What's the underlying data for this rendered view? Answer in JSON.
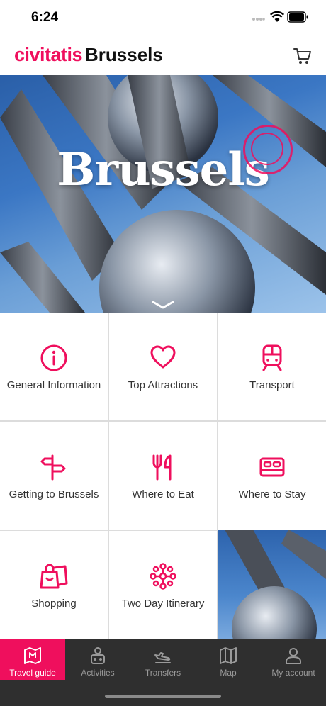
{
  "status_bar": {
    "time": "6:24"
  },
  "header": {
    "logo": "civitatis",
    "city": "Brussels"
  },
  "hero": {
    "title": "Brussels"
  },
  "colors": {
    "accent": "#ef0f5d",
    "tabbar": "#2f2f2f"
  },
  "menu": [
    {
      "label": "General Information",
      "icon": "info-icon"
    },
    {
      "label": "Top Attractions",
      "icon": "heart-icon"
    },
    {
      "label": "Transport",
      "icon": "train-icon"
    },
    {
      "label": "Getting to Brussels",
      "icon": "signpost-icon"
    },
    {
      "label": "Where to Eat",
      "icon": "fork-knife-icon"
    },
    {
      "label": "Where to Stay",
      "icon": "bed-icon"
    },
    {
      "label": "Shopping",
      "icon": "shopping-bags-icon"
    },
    {
      "label": "Two Day Itinerary",
      "icon": "itinerary-icon"
    }
  ],
  "tabs": [
    {
      "label": "Travel guide",
      "icon": "map-guide-icon",
      "active": true
    },
    {
      "label": "Activities",
      "icon": "activities-icon",
      "active": false
    },
    {
      "label": "Transfers",
      "icon": "plane-icon",
      "active": false
    },
    {
      "label": "Map",
      "icon": "map-icon",
      "active": false
    },
    {
      "label": "My account",
      "icon": "user-icon",
      "active": false
    }
  ]
}
